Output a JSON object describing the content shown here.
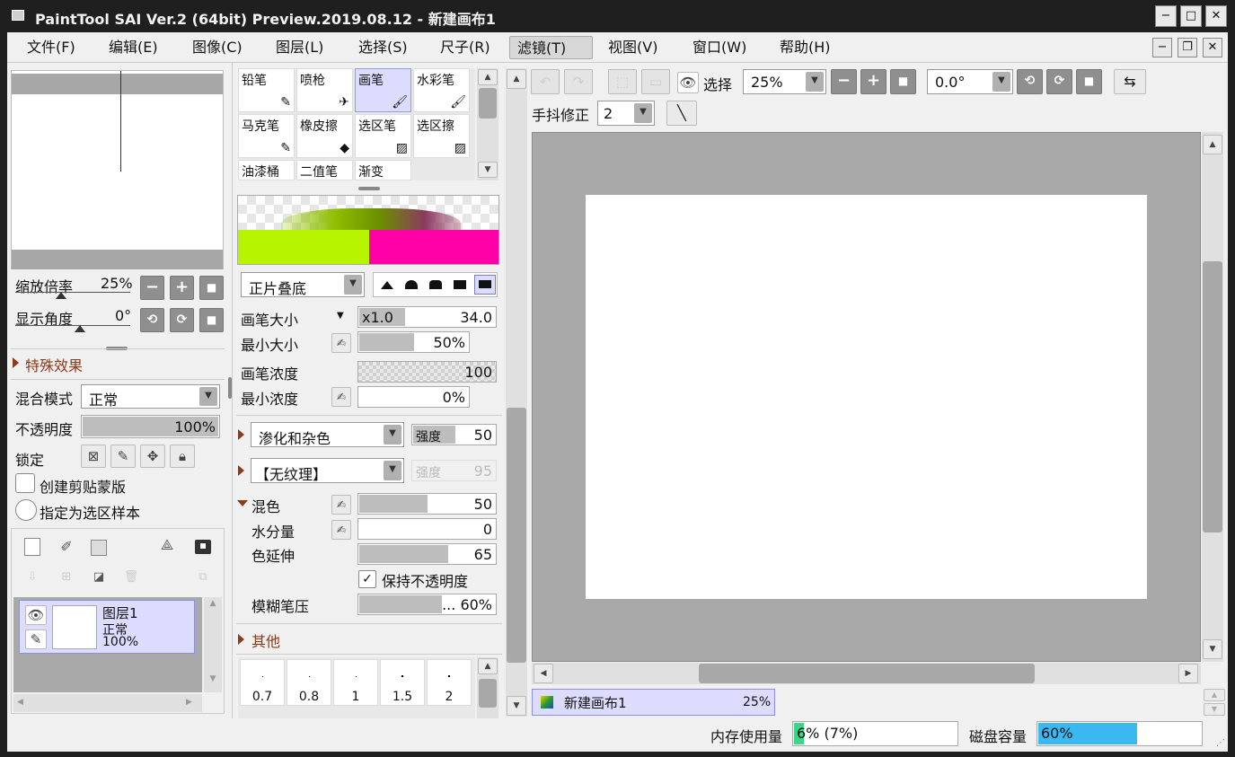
{
  "app": {
    "title": "PaintTool SAI Ver.2 (64bit) Preview.2019.08.12 - 新建画布1"
  },
  "menu": [
    {
      "label": "文件(F)"
    },
    {
      "label": "编辑(E)"
    },
    {
      "label": "图像(C)"
    },
    {
      "label": "图层(L)"
    },
    {
      "label": "选择(S)"
    },
    {
      "label": "尺子(R)"
    },
    {
      "label": "滤镜(T)"
    },
    {
      "label": "视图(V)"
    },
    {
      "label": "窗口(W)"
    },
    {
      "label": "帮助(H)"
    }
  ],
  "navigator": {
    "zoom_label": "缩放倍率",
    "zoom_value": "25%",
    "angle_label": "显示角度",
    "angle_value": "0°"
  },
  "layer_props": {
    "effects_label": "特殊效果",
    "blend_label": "混合模式",
    "blend_value": "正常",
    "opacity_label": "不透明度",
    "opacity_value": "100%",
    "lock_label": "锁定",
    "clip_label": "创建剪贴蒙版",
    "sample_label": "指定为选区样本"
  },
  "layers": [
    {
      "name": "图层1",
      "mode": "正常",
      "opacity": "100%"
    }
  ],
  "tools": [
    {
      "label": "铅笔"
    },
    {
      "label": "喷枪"
    },
    {
      "label": "画笔"
    },
    {
      "label": "水彩笔"
    },
    {
      "label": "马克笔"
    },
    {
      "label": "橡皮擦"
    },
    {
      "label": "选区笔"
    },
    {
      "label": "选区擦"
    },
    {
      "label": "油漆桶"
    },
    {
      "label": "二值笔"
    },
    {
      "label": "渐变"
    }
  ],
  "brush": {
    "blend_mode": "正片叠底",
    "size_label": "画笔大小",
    "size_mult": "x1.0",
    "size_value": "34.0",
    "min_size_label": "最小大小",
    "min_size_value": "50%",
    "density_label": "画笔浓度",
    "density_value": "100",
    "min_density_label": "最小浓度",
    "min_density_value": "0%",
    "texture1": "渗化和杂色",
    "texture1_strength_label": "强度",
    "texture1_strength": "50",
    "texture2": "【无纹理】",
    "texture2_strength_label": "强度",
    "texture2_strength": "95",
    "mix_label": "混色",
    "mix_value": "50",
    "water_label": "水分量",
    "water_value": "0",
    "stretch_label": "色延伸",
    "stretch_value": "65",
    "keep_opacity_label": "保持不透明度",
    "blur_label": "模糊笔压",
    "blur_value": "... 60%",
    "other_label": "其他",
    "sizes": [
      "0.7",
      "0.8",
      "1",
      "1.5",
      "2"
    ],
    "color_left": "#b7f400",
    "color_right": "#ff00a6"
  },
  "toolbar": {
    "select_label": "选择",
    "zoom_value": "25%",
    "angle_value": "0.0°",
    "stabilizer_label": "手抖修正",
    "stabilizer_value": "2"
  },
  "doc_tab": {
    "name": "新建画布1",
    "zoom": "25%"
  },
  "status": {
    "memory_label": "内存使用量",
    "memory_value": "6% (7%)",
    "memory_fraction": 0.06,
    "disk_label": "磁盘容量",
    "disk_value": "60%",
    "disk_fraction": 0.6
  }
}
